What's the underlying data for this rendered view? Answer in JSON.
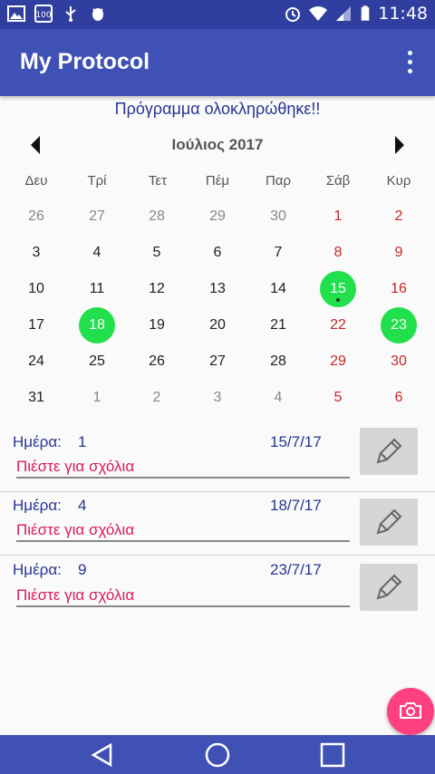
{
  "status_bar": {
    "time": "11:48",
    "left_icons": [
      "image-icon",
      "hundred-icon",
      "usb-icon",
      "android-debug-icon"
    ],
    "right_icons": [
      "alarm-icon",
      "wifi-icon",
      "signal-icon",
      "battery-icon"
    ]
  },
  "app_bar": {
    "title": "My Protocol",
    "menu_icon": "overflow-menu-icon"
  },
  "completed_message": "Πρόγραμμα ολοκληρώθηκε!!",
  "calendar": {
    "month_title": "Ιούλιος 2017",
    "prev_icon": "chevron-left-icon",
    "next_icon": "chevron-right-icon",
    "weekdays": [
      "Δευ",
      "Τρί",
      "Τετ",
      "Πέμ",
      "Παρ",
      "Σάβ",
      "Κυρ"
    ],
    "weeks": [
      [
        "26",
        "27",
        "28",
        "29",
        "30",
        "1",
        "2"
      ],
      [
        "3",
        "4",
        "5",
        "6",
        "7",
        "8",
        "9"
      ],
      [
        "10",
        "11",
        "12",
        "13",
        "14",
        "15",
        "16"
      ],
      [
        "17",
        "18",
        "19",
        "20",
        "21",
        "22",
        "23"
      ],
      [
        "24",
        "25",
        "26",
        "27",
        "28",
        "29",
        "30"
      ],
      [
        "31",
        "1",
        "2",
        "3",
        "4",
        "5",
        "6"
      ]
    ],
    "highlighted_days": [
      "15",
      "18",
      "23"
    ],
    "accent_color": "#21e04c",
    "weekend_color": "#c62828"
  },
  "entries": [
    {
      "day_label": "Ημέρα:",
      "day_number": "1",
      "date": "15/7/17",
      "comment_placeholder": "Πιέστε για σχόλια",
      "edit_icon": "pencil-icon"
    },
    {
      "day_label": "Ημέρα:",
      "day_number": "4",
      "date": "18/7/17",
      "comment_placeholder": "Πιέστε για σχόλια",
      "edit_icon": "pencil-icon"
    },
    {
      "day_label": "Ημέρα:",
      "day_number": "9",
      "date": "23/7/17",
      "comment_placeholder": "Πιέστε για σχόλια",
      "edit_icon": "pencil-icon"
    }
  ],
  "fab": {
    "icon": "camera-icon",
    "color": "#ff4081"
  },
  "nav_bar": {
    "icons": [
      "back-icon",
      "home-icon",
      "recents-icon"
    ]
  },
  "colors": {
    "primary": "#3f51b5",
    "primary_dark": "#303f9f",
    "text_accent": "#283593",
    "comment_color": "#d81b60"
  }
}
